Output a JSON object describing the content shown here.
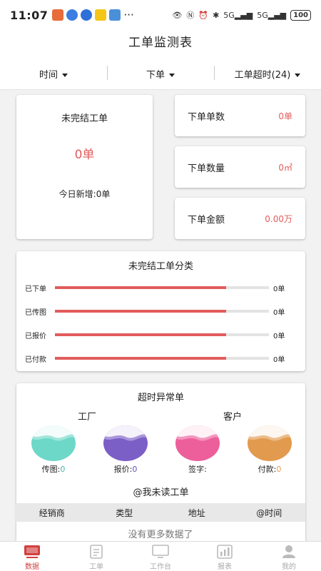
{
  "status": {
    "time": "11:07",
    "more": "···",
    "signal1": "5G",
    "signal2": "5G",
    "battery": "100"
  },
  "page_title": "工单监测表",
  "filters": [
    {
      "label": "时间"
    },
    {
      "label": "下单"
    },
    {
      "label": "工单超时(24)"
    }
  ],
  "unfinished": {
    "title": "未完结工单",
    "value": "0单",
    "today": "今日新增:0单"
  },
  "stats": [
    {
      "label": "下单单数",
      "value": "0单"
    },
    {
      "label": "下单数量",
      "value": "0㎡"
    },
    {
      "label": "下单金额",
      "value": "0.00万"
    }
  ],
  "category": {
    "title": "未完结工单分类",
    "rows": [
      {
        "label": "已下单",
        "value": "0单",
        "fill": 0.8
      },
      {
        "label": "已传图",
        "value": "0单",
        "fill": 0.8
      },
      {
        "label": "已报价",
        "value": "0单",
        "fill": 0.8
      },
      {
        "label": "已付款",
        "value": "0单",
        "fill": 0.8
      }
    ]
  },
  "timeout": {
    "title": "超时异常单",
    "factory": "工厂",
    "customer": "客户",
    "balls": [
      {
        "label": "传图:",
        "value": "0",
        "color": "#6ed8c8",
        "value_color": "#3fb7a6"
      },
      {
        "label": "报价:",
        "value": "0",
        "color": "#7b5fc6",
        "value_color": "#6a4fb8"
      },
      {
        "label": "签字:",
        "value": "",
        "color": "#ec5f9a",
        "value_color": "#ec5f9a"
      },
      {
        "label": "付款:",
        "value": "0",
        "color": "#e29a4e",
        "value_color": "#e29a4e"
      }
    ]
  },
  "unread": {
    "title": "@我未读工单",
    "columns": [
      "经销商",
      "类型",
      "地址",
      "@时间"
    ],
    "empty": "没有更多数据了"
  },
  "tabs": [
    {
      "label": "数据",
      "icon": "monitor-icon",
      "active": true
    },
    {
      "label": "工单",
      "icon": "document-icon",
      "active": false
    },
    {
      "label": "工作台",
      "icon": "desktop-icon",
      "active": false
    },
    {
      "label": "报表",
      "icon": "chart-icon",
      "active": false
    },
    {
      "label": "我的",
      "icon": "user-icon",
      "active": false
    }
  ]
}
